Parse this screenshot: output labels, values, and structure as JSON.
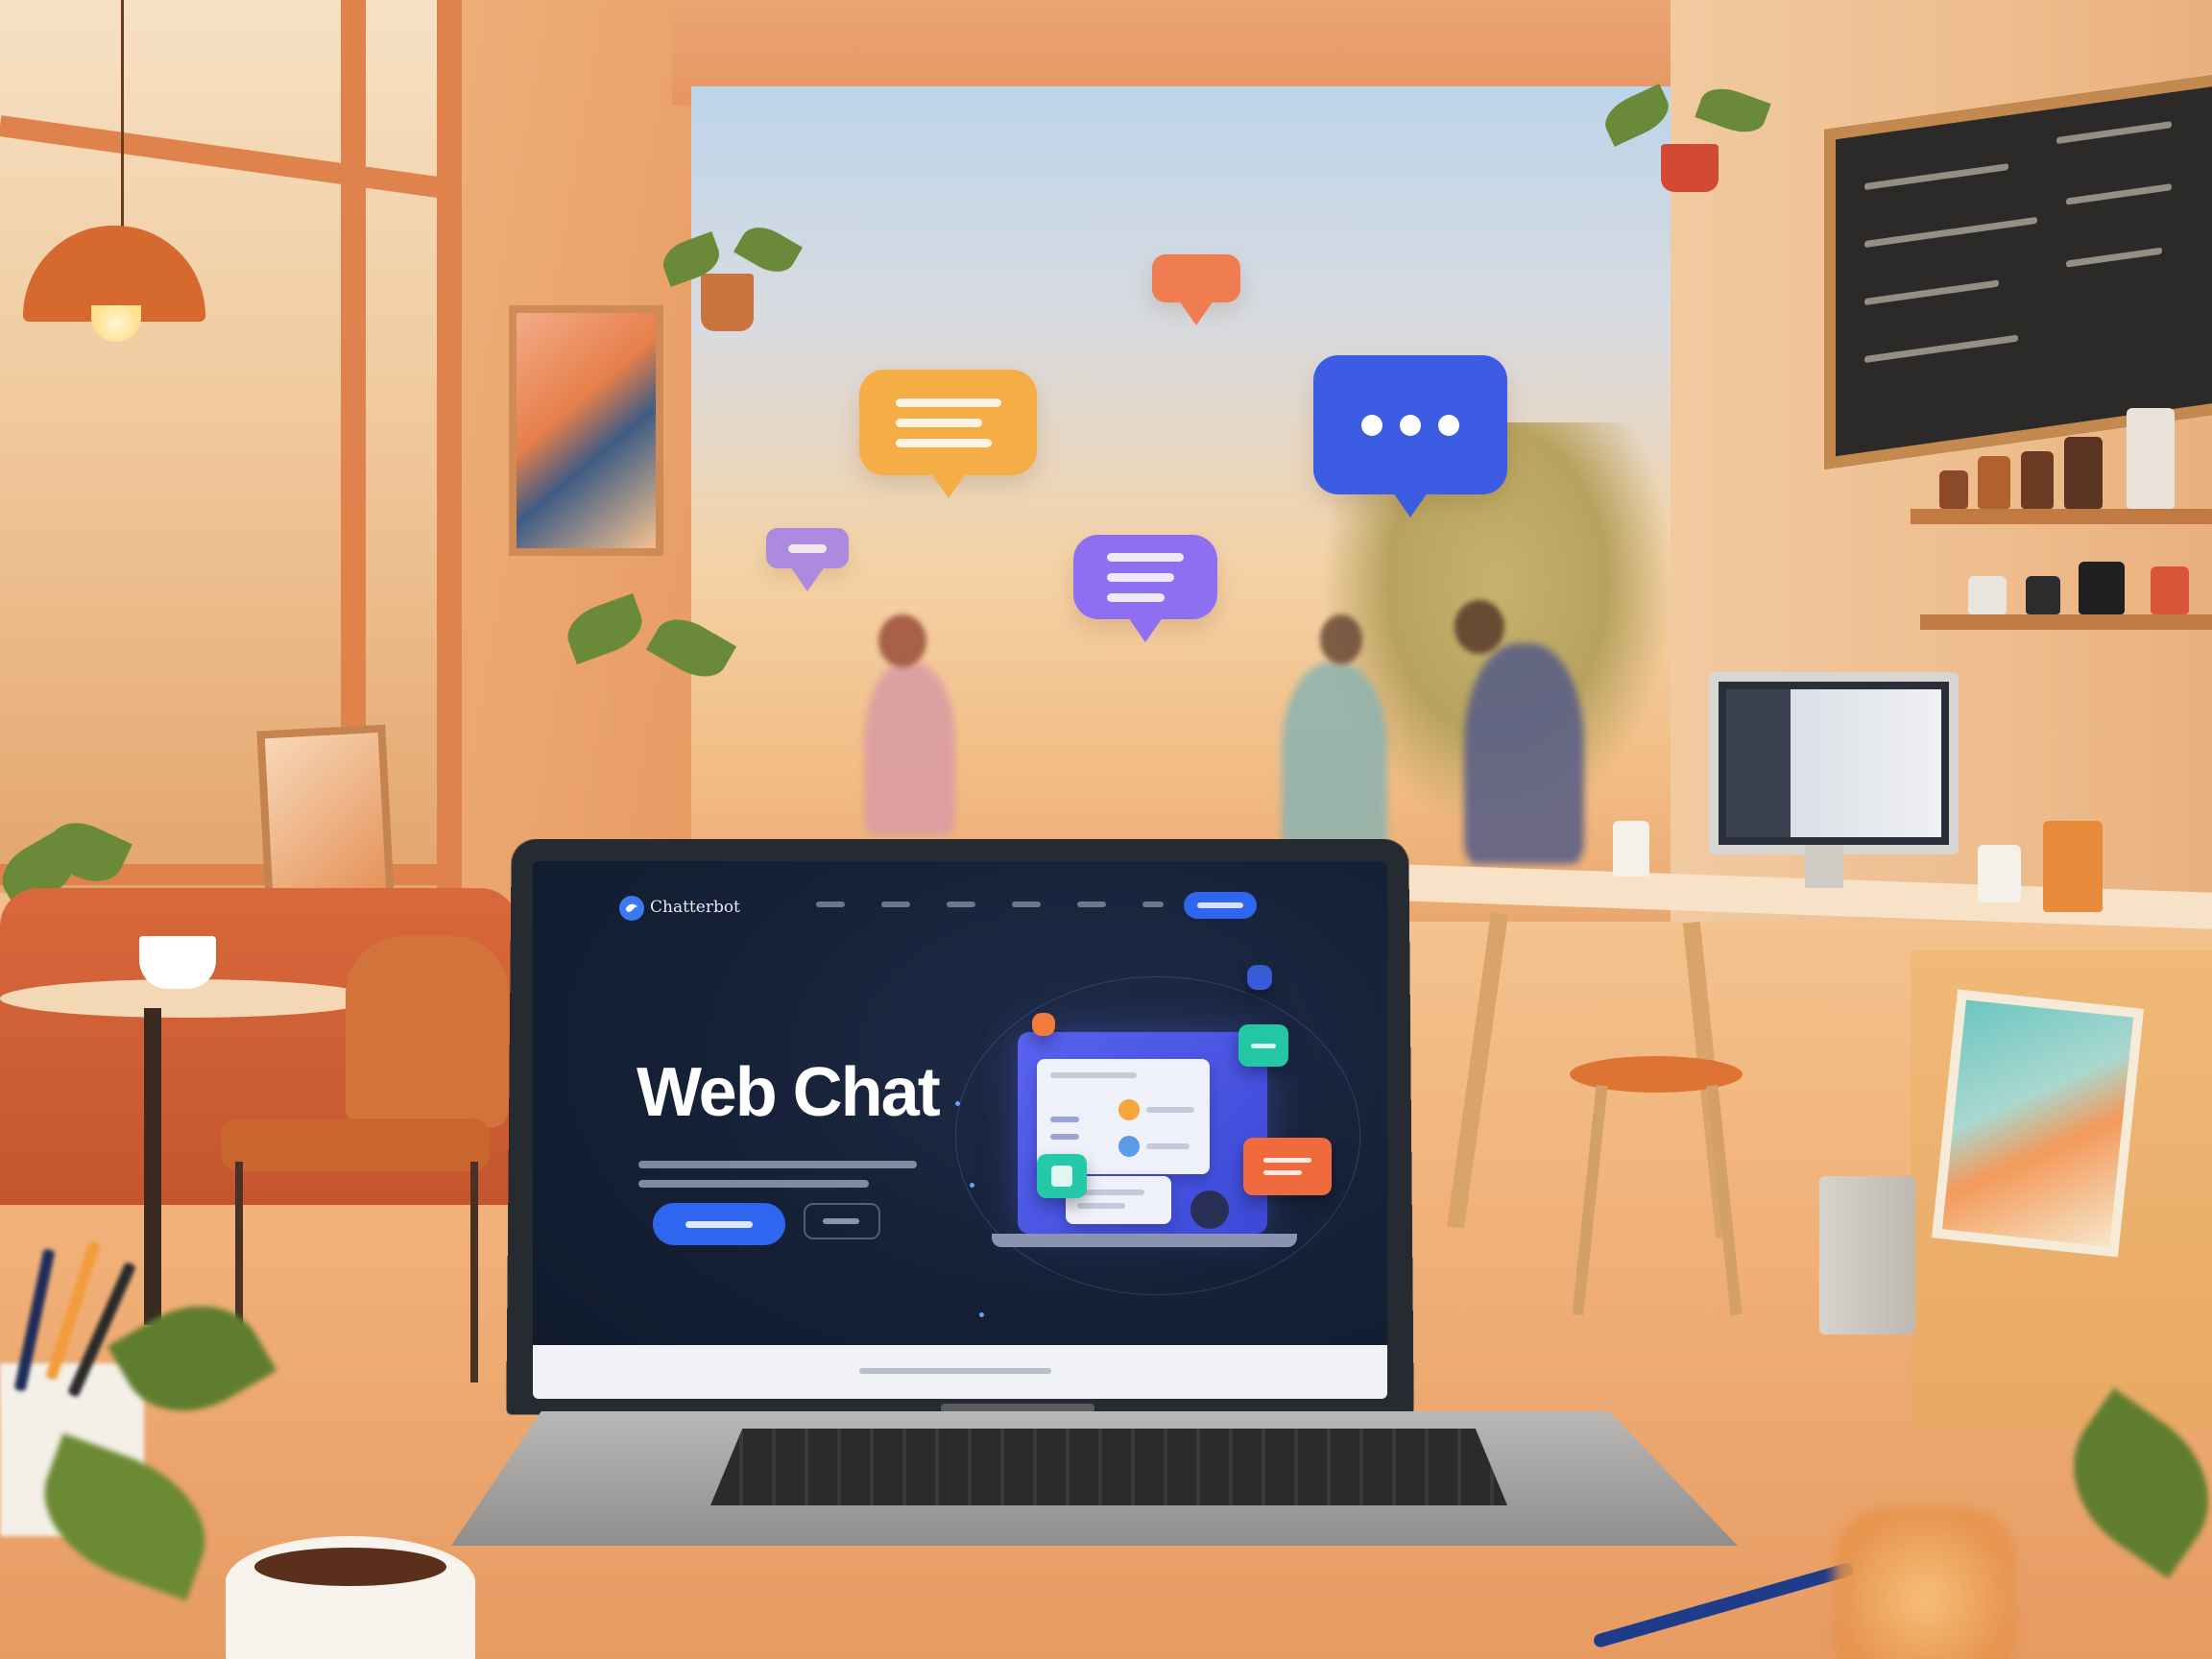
{
  "laptop_screen": {
    "brand": {
      "name": "Chatterbot"
    },
    "nav_links": [
      "",
      "",
      "",
      "",
      "",
      "",
      ""
    ],
    "hero": {
      "title": "Web Chat"
    }
  },
  "floating_bubbles": [
    {
      "icon": "message-lines-icon",
      "color": "#f5ad46"
    },
    {
      "icon": "typing-dots-icon",
      "color": "#3c5de3"
    },
    {
      "icon": "message-lines-icon",
      "color": "#8e6ff2"
    },
    {
      "icon": "message-small-icon",
      "color": "#f07d52"
    },
    {
      "icon": "message-small-icon",
      "color": "#a07ee8"
    }
  ],
  "colors": {
    "accent": "#2f66f0",
    "screen_bg": "#152036",
    "warm_light": "#f2b47a"
  }
}
